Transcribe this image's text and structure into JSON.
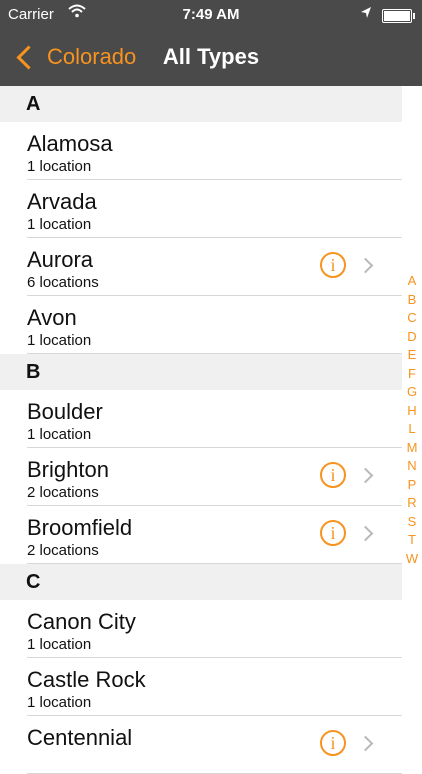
{
  "status": {
    "carrier": "Carrier",
    "time": "7:49 AM"
  },
  "nav": {
    "back_label": "Colorado",
    "title": "All Types"
  },
  "sections": [
    {
      "header": "A",
      "rows": [
        {
          "name": "Alamosa",
          "count": "1 location",
          "info": false
        },
        {
          "name": "Arvada",
          "count": "1 location",
          "info": false
        },
        {
          "name": "Aurora",
          "count": "6 locations",
          "info": true
        },
        {
          "name": "Avon",
          "count": "1 location",
          "info": false
        }
      ]
    },
    {
      "header": "B",
      "rows": [
        {
          "name": "Boulder",
          "count": "1 location",
          "info": false
        },
        {
          "name": "Brighton",
          "count": "2 locations",
          "info": true
        },
        {
          "name": "Broomfield",
          "count": "2 locations",
          "info": true
        }
      ]
    },
    {
      "header": "C",
      "rows": [
        {
          "name": "Canon City",
          "count": "1 location",
          "info": false
        },
        {
          "name": "Castle Rock",
          "count": "1 location",
          "info": false
        },
        {
          "name": "Centennial",
          "count": "",
          "info": true
        }
      ]
    }
  ],
  "index": [
    "A",
    "B",
    "C",
    "D",
    "E",
    "F",
    "G",
    "H",
    "L",
    "M",
    "N",
    "P",
    "R",
    "S",
    "T",
    "W"
  ],
  "colors": {
    "accent": "#f7931e",
    "navbar": "#4a4a4a"
  }
}
